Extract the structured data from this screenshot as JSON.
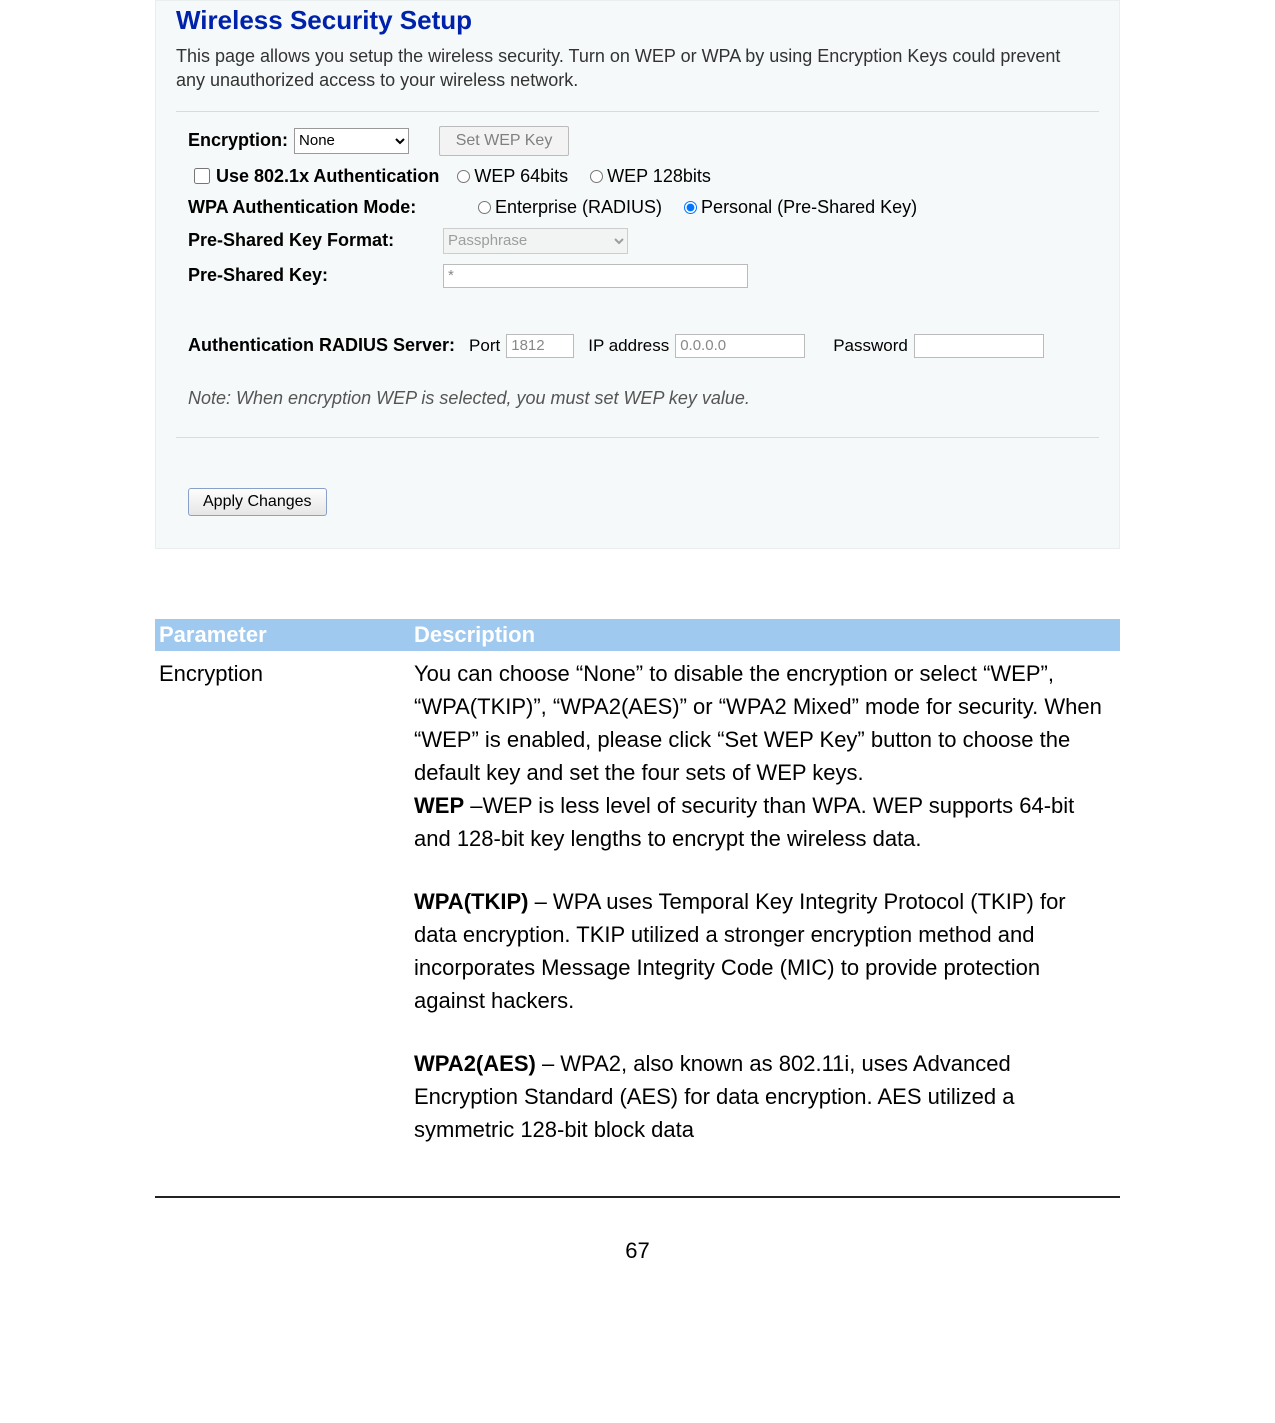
{
  "panel": {
    "title": "Wireless Security Setup",
    "intro": "This page allows you setup the wireless security. Turn on WEP or WPA by using Encryption Keys could prevent any unauthorized access to your wireless network.",
    "encryption_label": "Encryption:",
    "encryption_value": "None",
    "set_wep_button": "Set WEP Key",
    "use_8021x_label": "Use 802.1x Authentication",
    "wep64_label": "WEP 64bits",
    "wep128_label": "WEP 128bits",
    "wpa_auth_label": "WPA Authentication Mode:",
    "enterprise_label": "Enterprise (RADIUS)",
    "personal_label": "Personal (Pre-Shared Key)",
    "psk_format_label": "Pre-Shared Key Format:",
    "psk_format_value": "Passphrase",
    "psk_label": "Pre-Shared Key:",
    "psk_value": "*",
    "radius_label": "Authentication RADIUS Server:",
    "port_label": "Port",
    "port_value": "1812",
    "ip_label": "IP address",
    "ip_value": "0.0.0.0",
    "password_label": "Password",
    "note": "Note: When encryption WEP is selected, you must set WEP key value.",
    "apply_button": "Apply Changes"
  },
  "table": {
    "header_parameter": "Parameter",
    "header_description": "Description",
    "row_parameter": "Encryption",
    "desc_main": "You can choose “None” to disable the encryption or select “WEP”, “WPA(TKIP)”, “WPA2(AES)” or “WPA2 Mixed” mode for security. When “WEP” is enabled, please click “Set WEP Key” button to choose the default key and set the four sets of WEP keys.",
    "wep_bold": "WEP",
    "wep_text": " –WEP is less level of security than WPA. WEP supports 64-bit and 128-bit key lengths to encrypt the wireless data.",
    "wpa_bold": "WPA(TKIP)",
    "wpa_text": " – WPA uses Temporal Key Integrity Protocol (TKIP) for data encryption. TKIP utilized a stronger encryption method and incorporates Message Integrity Code (MIC) to provide protection against hackers.",
    "wpa2_bold": "WPA2(AES)",
    "wpa2_text": " – WPA2, also known as 802.11i, uses Advanced Encryption Standard (AES) for data encryption. AES utilized a symmetric 128-bit block data"
  },
  "page_number": "67"
}
